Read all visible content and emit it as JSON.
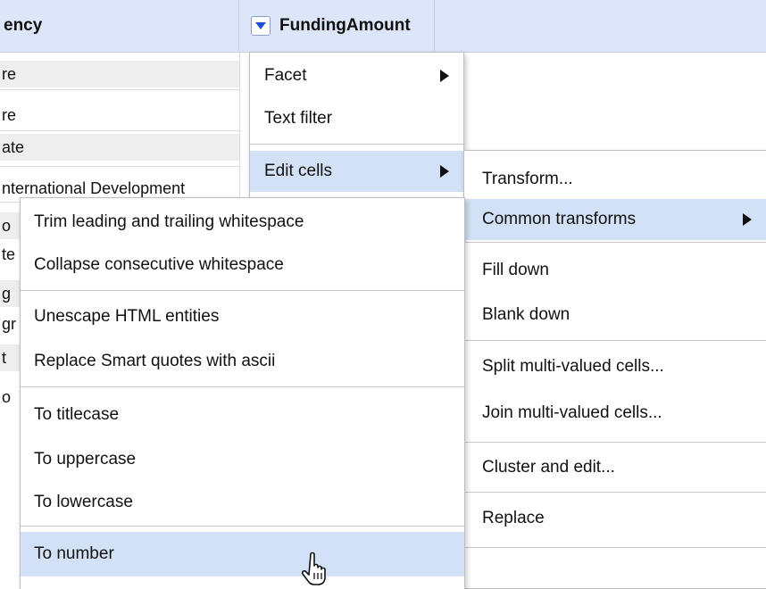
{
  "table": {
    "headers": {
      "agency": "ency",
      "funding": "FundingAmount"
    },
    "agency_cells": [
      "re",
      "re",
      "ate",
      "nternational Development",
      "o",
      "te",
      "g",
      "gr",
      "t",
      "o"
    ]
  },
  "column_menu": {
    "items": [
      {
        "label": "Facet",
        "has_submenu": true
      },
      {
        "label": "Text filter",
        "has_submenu": false
      },
      {
        "label": "Edit cells",
        "has_submenu": true,
        "selected": true
      }
    ]
  },
  "edit_cells_menu": {
    "items": [
      {
        "label": "Transform..."
      },
      {
        "label": "Common transforms",
        "has_submenu": true,
        "selected": true
      },
      {
        "label": "Fill down"
      },
      {
        "label": "Blank down"
      },
      {
        "label": "Split multi-valued cells..."
      },
      {
        "label": "Join multi-valued cells..."
      },
      {
        "label": "Cluster and edit..."
      },
      {
        "label": "Replace"
      }
    ]
  },
  "common_transforms_menu": {
    "items": [
      {
        "label": "Trim leading and trailing whitespace"
      },
      {
        "label": "Collapse consecutive whitespace"
      },
      {
        "label": "Unescape HTML entities"
      },
      {
        "label": "Replace Smart quotes with ascii"
      },
      {
        "label": "To titlecase"
      },
      {
        "label": "To uppercase"
      },
      {
        "label": "To lowercase"
      },
      {
        "label": "To number",
        "selected": true
      }
    ]
  },
  "colors": {
    "header_bg": "#dde6f8",
    "selection_bg": "#d3e1f6",
    "dropdown_arrow": "#1f4fd6"
  },
  "icons": {
    "column_dropdown": "triangle-down-icon",
    "submenu": "triangle-right-icon",
    "cursor": "hand-pointer-icon"
  }
}
